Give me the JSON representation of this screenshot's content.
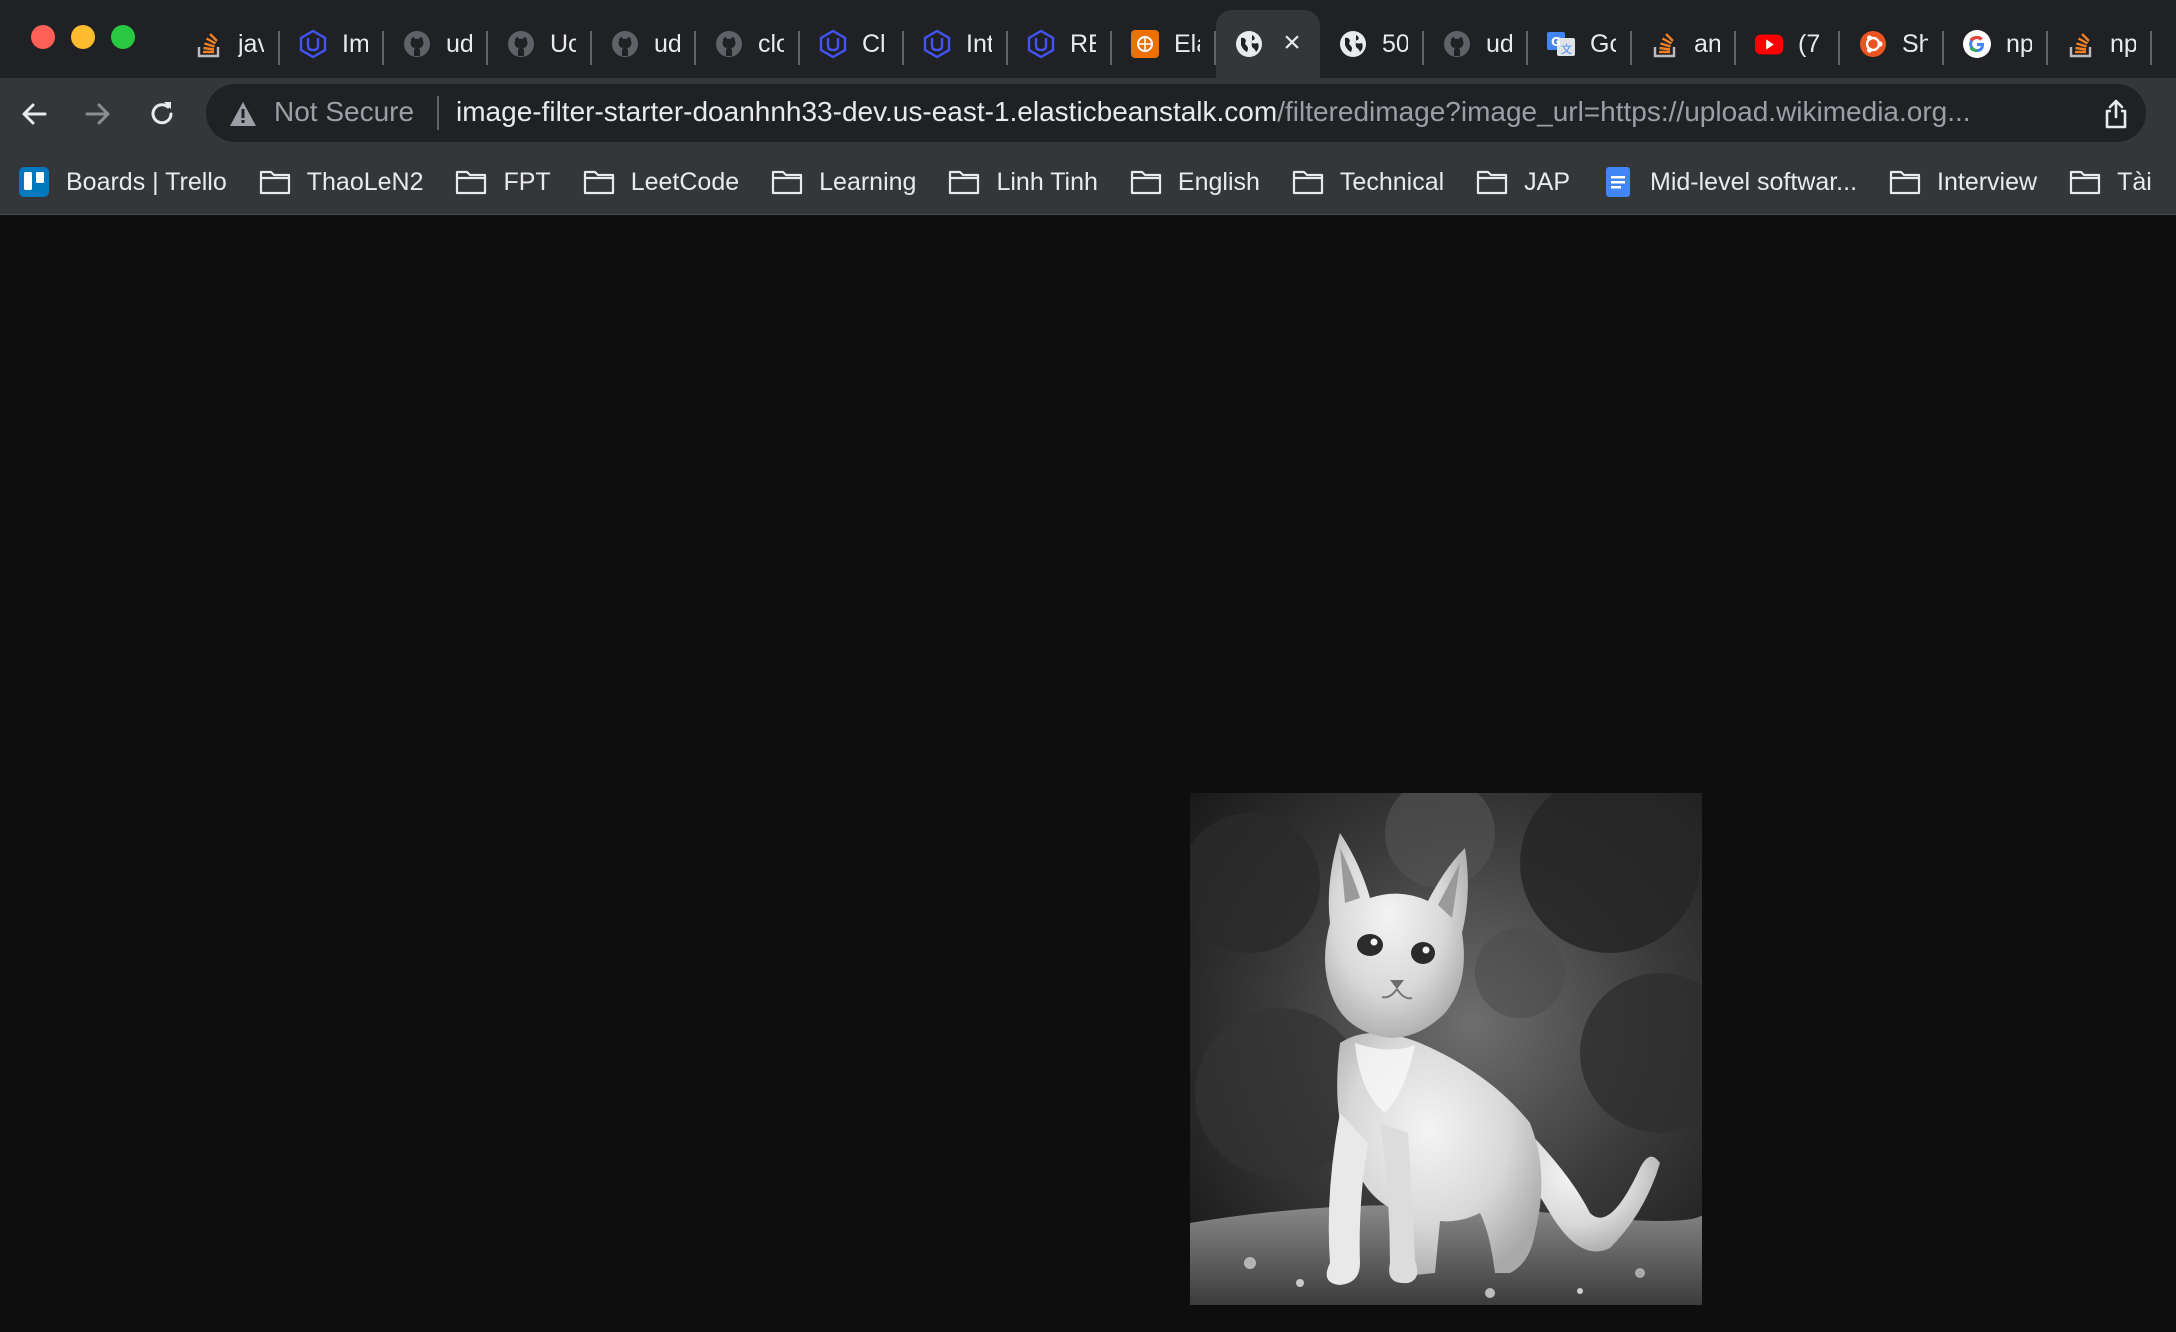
{
  "window": {
    "tabs": [
      {
        "title": "java",
        "icon": "stackoverflow-icon"
      },
      {
        "title": "Im",
        "icon": "udacity-icon"
      },
      {
        "title": "ud",
        "icon": "github-icon"
      },
      {
        "title": "Uc",
        "icon": "github-icon"
      },
      {
        "title": "ud",
        "icon": "github-icon"
      },
      {
        "title": "clo",
        "icon": "github-icon"
      },
      {
        "title": "Cl",
        "icon": "udacity-icon"
      },
      {
        "title": "Int",
        "icon": "udacity-icon"
      },
      {
        "title": "RE",
        "icon": "udacity-icon"
      },
      {
        "title": "Ela",
        "icon": "aws-icon"
      },
      {
        "title": "",
        "icon": "globe-icon",
        "active": true
      },
      {
        "title": "50",
        "icon": "globe-icon"
      },
      {
        "title": "ud",
        "icon": "github-icon"
      },
      {
        "title": "Gc",
        "icon": "google-translate-icon"
      },
      {
        "title": "an",
        "icon": "stackoverflow-icon"
      },
      {
        "title": "(7",
        "icon": "youtube-icon"
      },
      {
        "title": "Sh",
        "icon": "ubuntu-icon"
      },
      {
        "title": "np",
        "icon": "google-icon"
      },
      {
        "title": "np",
        "icon": "stackoverflow-icon"
      }
    ]
  },
  "toolbar": {
    "security_label": "Not Secure",
    "url_host": "image-filter-starter-doanhnh33-dev.us-east-1.elasticbeanstalk.com",
    "url_path": "/filteredimage?image_url=https://upload.wikimedia.org..."
  },
  "bookmarks": [
    {
      "label": "Boards | Trello",
      "icon": "trello-icon"
    },
    {
      "label": "ThaoLeN2",
      "icon": "folder-icon"
    },
    {
      "label": "FPT",
      "icon": "folder-icon"
    },
    {
      "label": "LeetCode",
      "icon": "folder-icon"
    },
    {
      "label": "Learning",
      "icon": "folder-icon"
    },
    {
      "label": "Linh Tinh",
      "icon": "folder-icon"
    },
    {
      "label": "English",
      "icon": "folder-icon"
    },
    {
      "label": "Technical",
      "icon": "folder-icon"
    },
    {
      "label": "JAP",
      "icon": "folder-icon"
    },
    {
      "label": "Mid-level softwar...",
      "icon": "google-docs-icon"
    },
    {
      "label": "Interview",
      "icon": "folder-icon"
    },
    {
      "label": "Tài",
      "icon": "folder-icon"
    }
  ],
  "content": {
    "image_subject": "grayscale filtered photo of a kitten"
  },
  "colors": {
    "tabstrip_bg": "#202124",
    "toolbar_bg": "#35363a",
    "page_bg": "#0e0e0e"
  }
}
